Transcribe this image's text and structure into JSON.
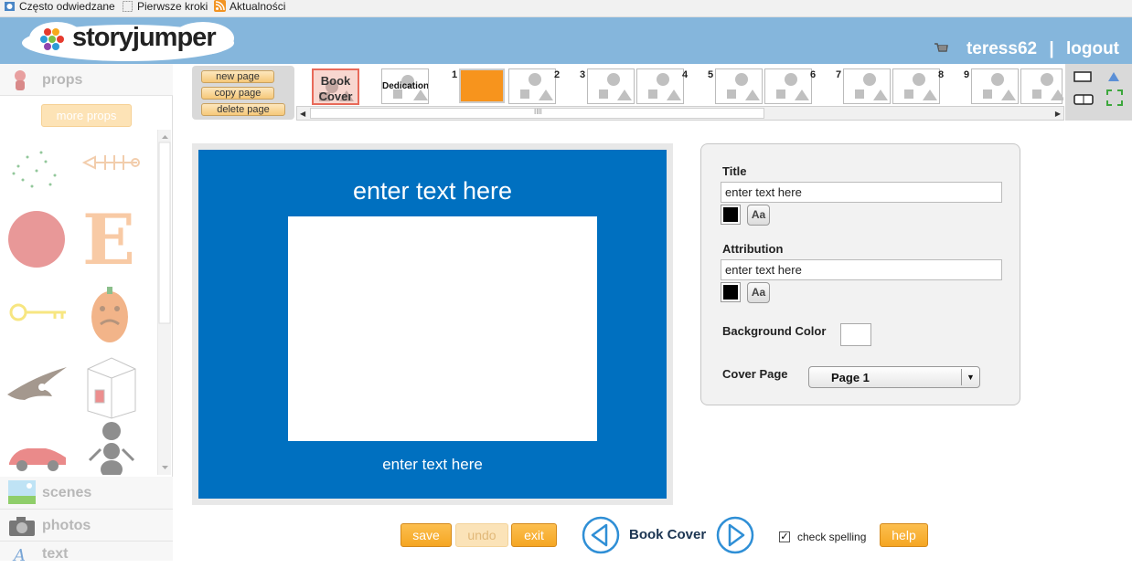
{
  "bookmarks": [
    "Często odwiedzane",
    "Pierwsze kroki",
    "Aktualności"
  ],
  "header": {
    "logo_text": "storyjumper",
    "username": "teress62",
    "separator": "|",
    "logout": "logout"
  },
  "left_panel": {
    "tabs": [
      {
        "label": "props"
      },
      {
        "label": "scenes"
      },
      {
        "label": "photos"
      },
      {
        "label": "text"
      }
    ],
    "more_props": "more props"
  },
  "page_buttons": {
    "new_page": "new page",
    "copy_page": "copy page",
    "delete_page": "delete page"
  },
  "pages": {
    "book_cover": [
      "Book",
      "Cover"
    ],
    "dedication": "Dedication",
    "numbers": [
      "1",
      "2",
      "3",
      "4",
      "5",
      "6",
      "7",
      "8",
      "9"
    ],
    "scroll_grip": "IIII"
  },
  "canvas": {
    "title_text": "enter text here",
    "attribution_text": "enter text here",
    "background_color": "#0070c0"
  },
  "properties": {
    "title_label": "Title",
    "title_value": "enter text here",
    "attribution_label": "Attribution",
    "attribution_value": "enter text here",
    "font_button": "Aa",
    "background_label": "Background Color",
    "cover_page_label": "Cover Page",
    "cover_page_value": "Page 1"
  },
  "bottom": {
    "save": "save",
    "undo": "undo",
    "exit": "exit",
    "current_page": "Book Cover",
    "check_spelling": "check spelling",
    "check_spelling_checked": true,
    "help": "help"
  },
  "colors": {
    "header": "#85b6dc",
    "accent_orange": "#f5a623",
    "cover_blue": "#0070c0",
    "nav_blue": "#2f8fd6"
  }
}
